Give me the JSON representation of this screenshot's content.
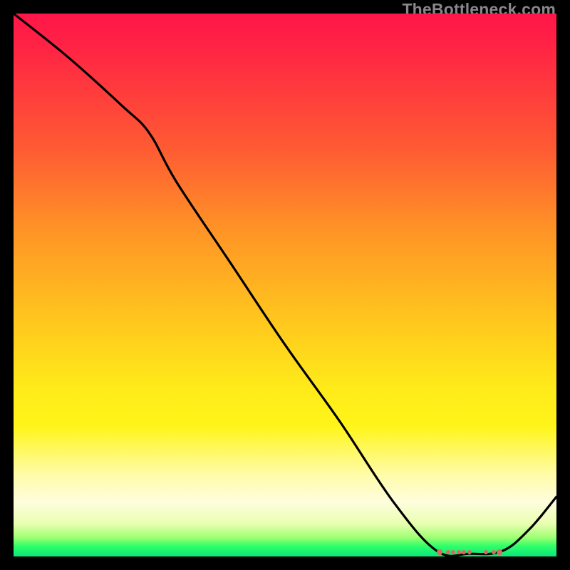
{
  "watermark": "TheBottleneck.com",
  "chart_data": {
    "type": "line",
    "title": "",
    "xlabel": "",
    "ylabel": "",
    "xlim": [
      0,
      100
    ],
    "ylim": [
      0,
      100
    ],
    "grid": false,
    "background": "rainbow-gradient-vertical",
    "series": [
      {
        "name": "curve",
        "x": [
          0,
          10,
          20,
          25,
          30,
          40,
          50,
          60,
          70,
          78,
          84,
          90,
          95,
          100
        ],
        "y": [
          100,
          92,
          83,
          78,
          69,
          54,
          39,
          25,
          10,
          1,
          0.5,
          1,
          5,
          11
        ]
      }
    ],
    "optimal_markers": {
      "y": 0.8,
      "x": [
        78.5,
        80,
        81,
        82,
        83,
        84,
        87,
        88.5,
        89.5
      ],
      "sizes": [
        8,
        6,
        6,
        6,
        6,
        6,
        6,
        6,
        8
      ]
    }
  },
  "colors": {
    "frame": "#000000",
    "curve": "#000000",
    "dots": "#d86b5c",
    "watermark": "#88888b"
  }
}
